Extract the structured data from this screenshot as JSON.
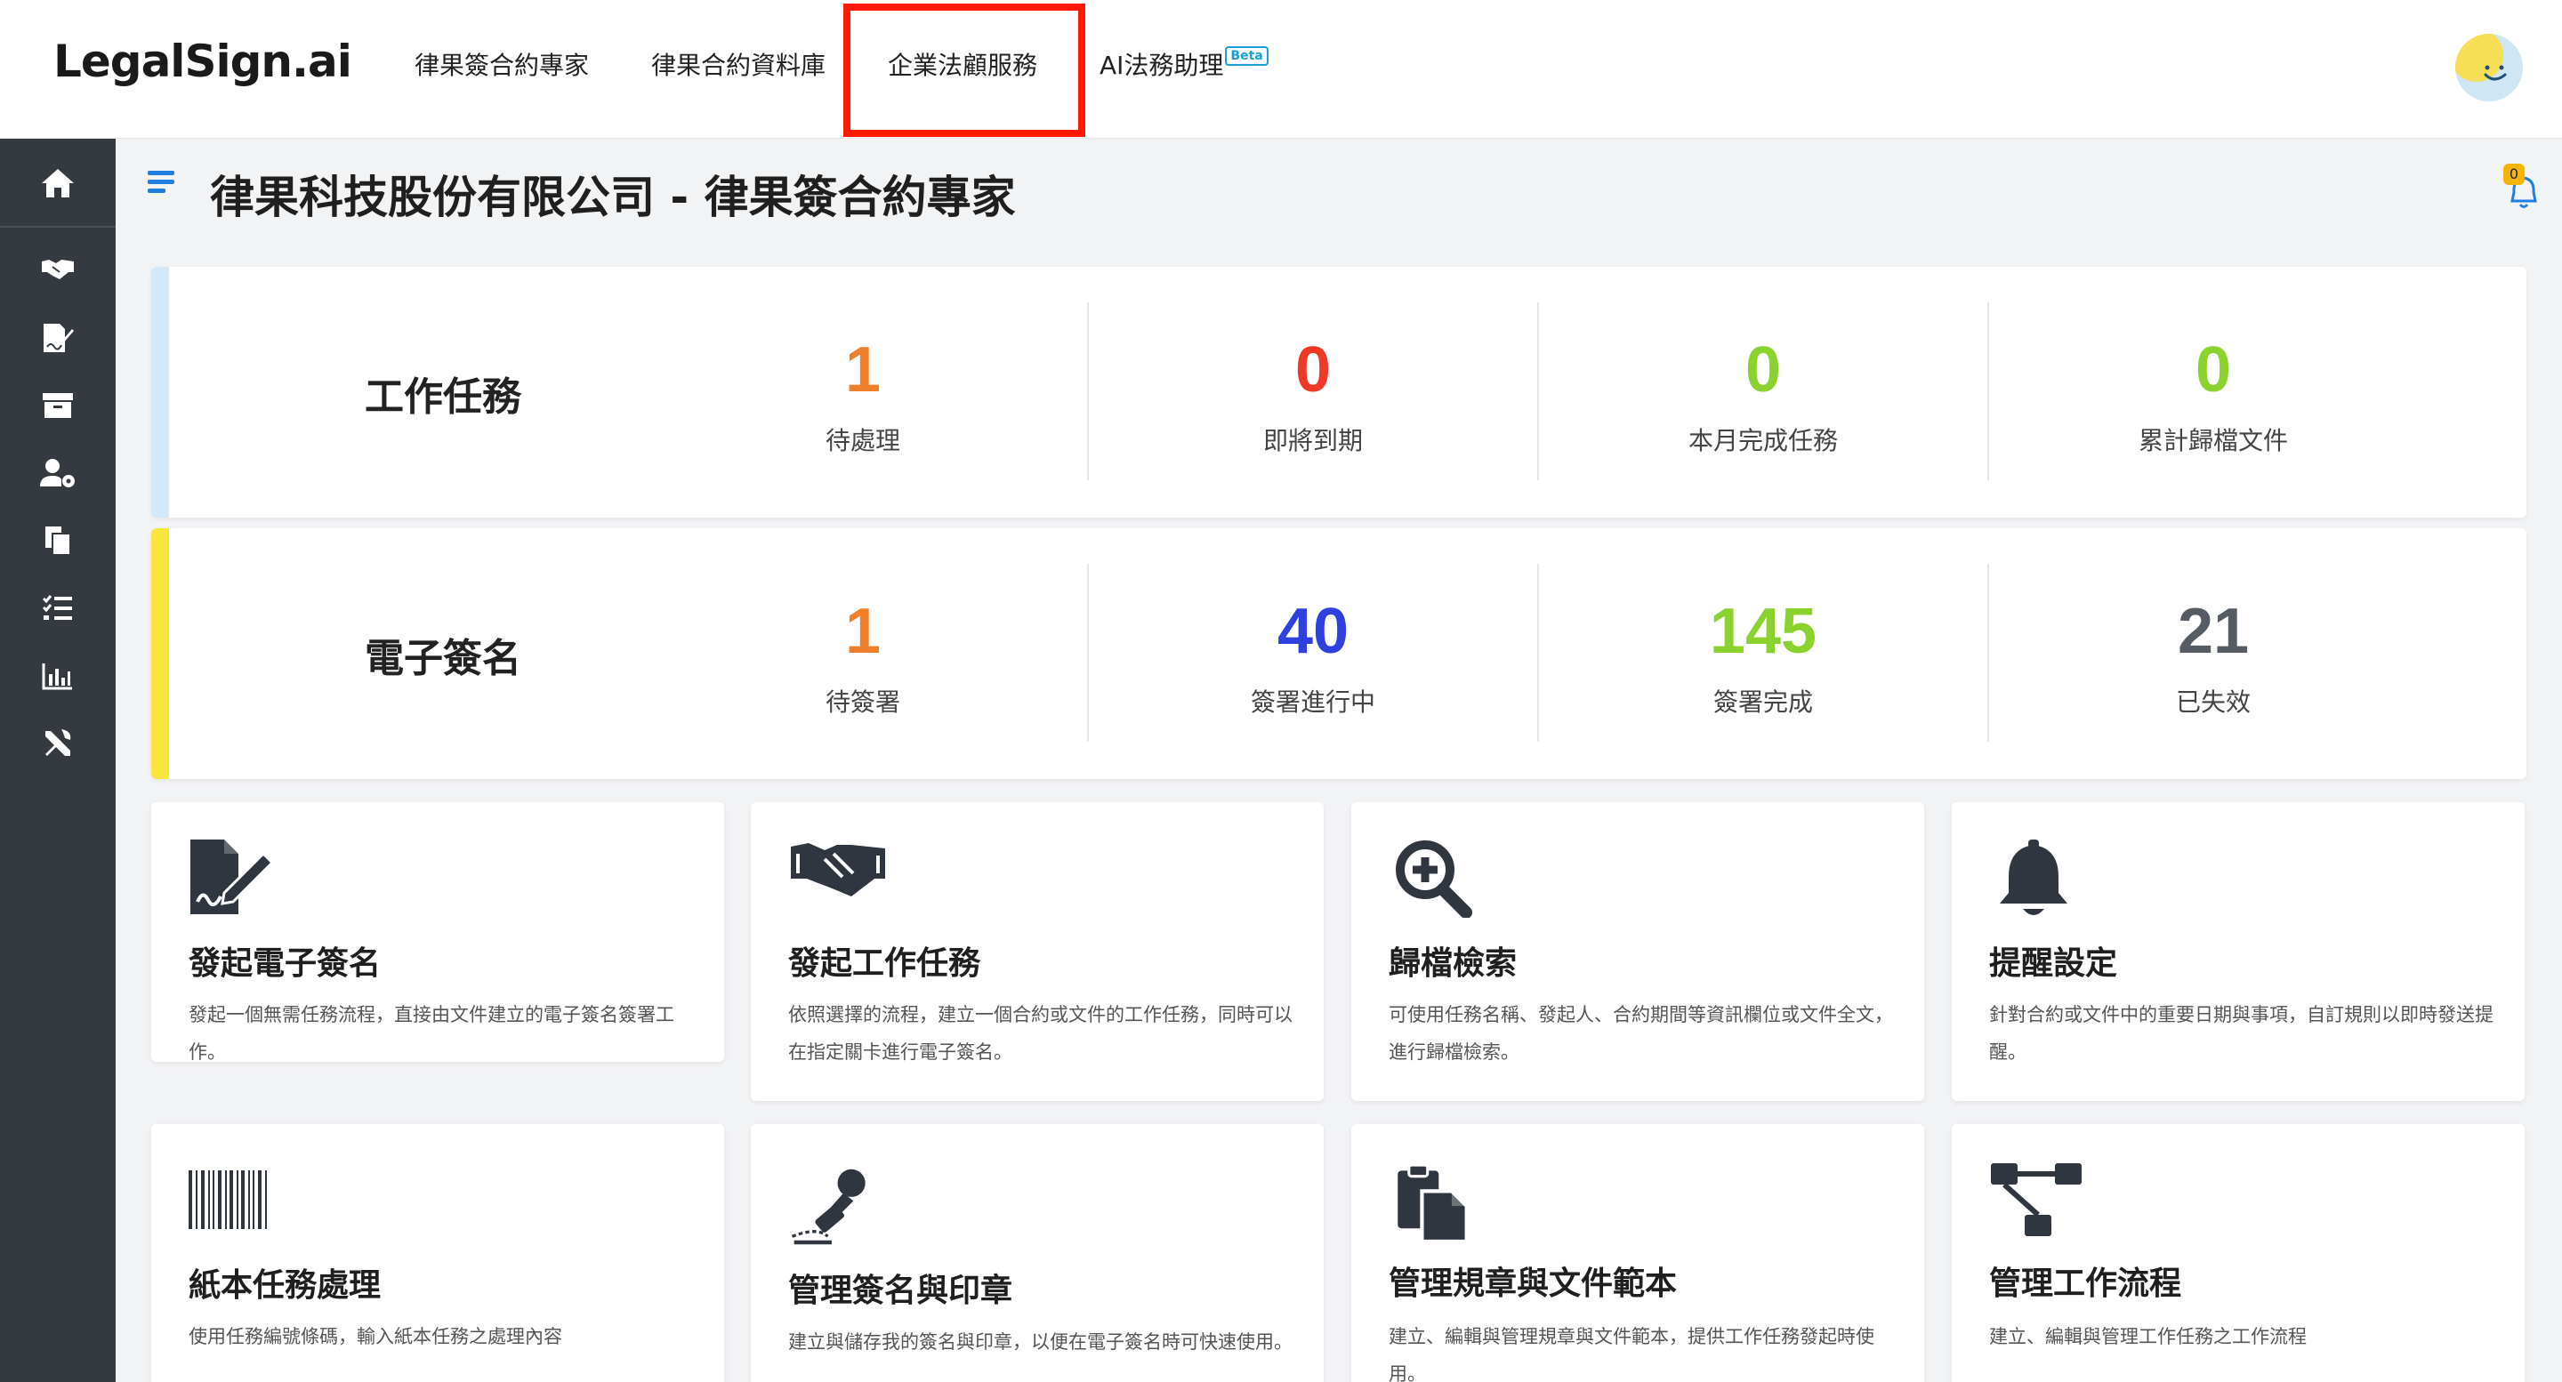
{
  "brand": {
    "logo": "LegalSign.ai"
  },
  "nav": {
    "items": [
      {
        "label": "律果簽合約專家"
      },
      {
        "label": "律果合約資料庫"
      },
      {
        "label": "企業法顧服務"
      },
      {
        "label": "AI法務助理",
        "badge": "Beta"
      }
    ]
  },
  "header": {
    "title": "律果科技股份有限公司 - 律果簽合約專家",
    "notification_count": "0"
  },
  "sidebar": {
    "items": [
      {
        "icon": "home-icon"
      },
      {
        "icon": "handshake-icon"
      },
      {
        "icon": "sign-document-icon"
      },
      {
        "icon": "archive-icon"
      },
      {
        "icon": "user-settings-icon"
      },
      {
        "icon": "copy-files-icon"
      },
      {
        "icon": "checklist-icon"
      },
      {
        "icon": "chart-icon"
      },
      {
        "icon": "tools-icon"
      }
    ]
  },
  "tasks": {
    "label": "工作任務",
    "accent": "#d3e8f8",
    "stats": [
      {
        "value": "1",
        "label": "待處理",
        "color": "#f07f2c"
      },
      {
        "value": "0",
        "label": "即將到期",
        "color": "#ee3a24"
      },
      {
        "value": "0",
        "label": "本月完成任務",
        "color": "#8bd22f"
      },
      {
        "value": "0",
        "label": "累計歸檔文件",
        "color": "#8bd22f"
      }
    ]
  },
  "esign": {
    "label": "電子簽名",
    "accent": "#fae53d",
    "stats": [
      {
        "value": "1",
        "label": "待簽署",
        "color": "#f07f2c"
      },
      {
        "value": "40",
        "label": "簽署進行中",
        "color": "#2f3fe0"
      },
      {
        "value": "145",
        "label": "簽署完成",
        "color": "#8bd22f"
      },
      {
        "value": "21",
        "label": "已失效",
        "color": "#555c63"
      }
    ]
  },
  "cards": [
    {
      "title": "發起電子簽名",
      "desc": "發起一個無需任務流程，直接由文件建立的電子簽名簽署工作。",
      "icon": "file-signature-icon"
    },
    {
      "title": "發起工作任務",
      "desc": "依照選擇的流程，建立一個合約或文件的工作任務，同時可以在指定關卡進行電子簽名。",
      "icon": "handshake-icon"
    },
    {
      "title": "歸檔檢索",
      "desc": "可使用任務名稱、發起人、合約期間等資訊欄位或文件全文，進行歸檔檢索。",
      "icon": "search-plus-icon"
    },
    {
      "title": "提醒設定",
      "desc": "針對合約或文件中的重要日期與事項，自訂規則以即時發送提醒。",
      "icon": "bell-icon"
    },
    {
      "title": "紙本任務處理",
      "desc": "使用任務編號條碼，輸入紙本任務之處理內容",
      "icon": "barcode-icon"
    },
    {
      "title": "管理簽名與印章",
      "desc": "建立與儲存我的簽名與印章，以便在電子簽名時可快速使用。",
      "icon": "stamp-icon"
    },
    {
      "title": "管理規章與文件範本",
      "desc": "建立、編輯與管理規章與文件範本，提供工作任務發起時使用。",
      "icon": "clipboard-files-icon"
    },
    {
      "title": "管理工作流程",
      "desc": "建立、編輯與管理工作任務之工作流程",
      "icon": "flow-icon"
    }
  ]
}
